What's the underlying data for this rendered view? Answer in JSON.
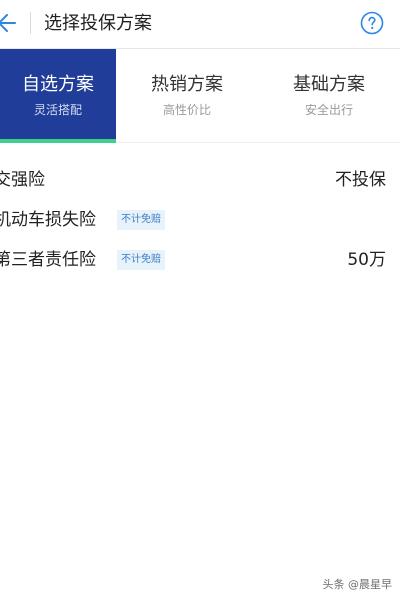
{
  "header": {
    "title": "选择投保方案",
    "back_icon": "arrow-left-icon",
    "help_icon": "question-circle-icon",
    "accent_color": "#2b86e4"
  },
  "tabs": [
    {
      "title": "自选方案",
      "subtitle": "灵活搭配",
      "active": true
    },
    {
      "title": "热销方案",
      "subtitle": "高性价比",
      "active": false
    },
    {
      "title": "基础方案",
      "subtitle": "安全出行",
      "active": false
    }
  ],
  "colors": {
    "active_tab_bg": "#203d99",
    "active_indicator": "#3fd08f",
    "badge_text": "#3a7fc6",
    "badge_bg": "#e8f2fb"
  },
  "coverage": [
    {
      "name": "交强险",
      "badge": "",
      "value": "不投保"
    },
    {
      "name": "机动车损失险",
      "badge": "不计免赔",
      "value": ""
    },
    {
      "name": "第三者责任险",
      "badge": "不计免赔",
      "value": "50万"
    }
  ],
  "watermark": "头条 @晨星早"
}
